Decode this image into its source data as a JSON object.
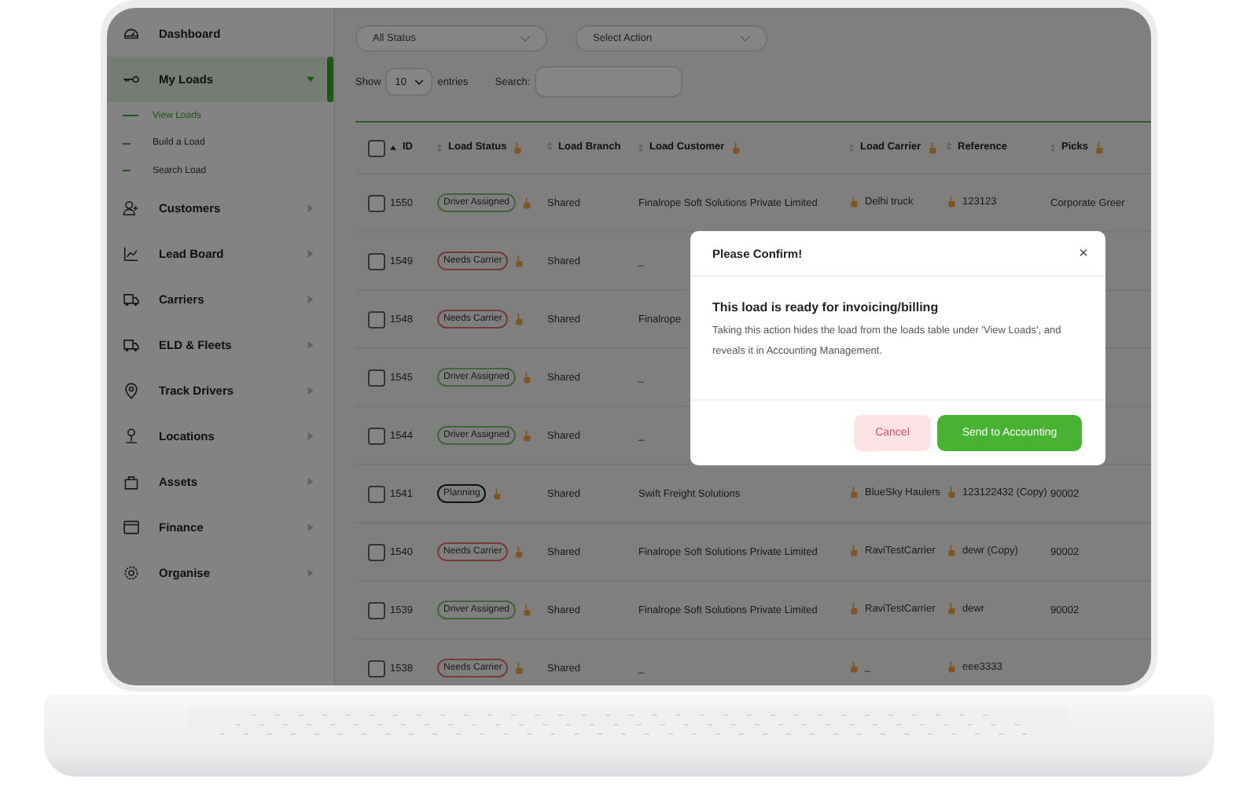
{
  "sidebar": {
    "items": [
      {
        "label": "Dashboard",
        "selected": false
      },
      {
        "label": "My Loads",
        "selected": true,
        "expanded": true,
        "children": [
          {
            "label": "View Loads",
            "selected": true
          },
          {
            "label": "Build a Load",
            "selected": false
          },
          {
            "label": "Search Load",
            "selected": false
          }
        ]
      },
      {
        "label": "Customers",
        "selected": false,
        "expanded": false
      },
      {
        "label": "Lead Board",
        "selected": false,
        "expanded": false
      },
      {
        "label": "Carriers",
        "selected": false,
        "expanded": false
      },
      {
        "label": "ELD & Fleets",
        "selected": false,
        "expanded": false
      },
      {
        "label": "Track Drivers",
        "selected": false,
        "expanded": false
      },
      {
        "label": "Locations",
        "selected": false,
        "expanded": false
      },
      {
        "label": "Assets",
        "selected": false,
        "expanded": false
      },
      {
        "label": "Finance",
        "selected": false,
        "expanded": false
      },
      {
        "label": "Organise",
        "selected": false,
        "expanded": false
      }
    ]
  },
  "filters": [
    {
      "value": "All Status"
    },
    {
      "value": "Select Action"
    }
  ],
  "length_control": {
    "before": "Show",
    "value": "10",
    "after": "entries"
  },
  "search": {
    "label": "Search:"
  },
  "table": {
    "header_checked": false,
    "columns": [
      {
        "label": "ID",
        "sorted": true,
        "hand": false
      },
      {
        "label": "Load Status",
        "sorted": false,
        "hand": true
      },
      {
        "label": "Load Branch",
        "sorted": false,
        "hand": false
      },
      {
        "label": "Load Customer",
        "sorted": false,
        "hand": true
      },
      {
        "label": "Load Carrier",
        "sorted": false,
        "hand": true
      },
      {
        "label": "Reference",
        "sorted": false,
        "hand": false
      },
      {
        "label": "Picks",
        "sorted": false,
        "hand": true
      }
    ],
    "rows": [
      {
        "checked": false,
        "id": "1550",
        "status": {
          "text": "Driver Assigned",
          "kind": "assigned"
        },
        "branch": "Shared",
        "customer": "Finalrope Soft Solutions Private Limited",
        "carrier": "Delhi truck",
        "reference": "123123",
        "picks": "Corporate Greer"
      },
      {
        "checked": false,
        "id": "1549",
        "status": {
          "text": "Needs Carrier",
          "kind": "needs"
        },
        "branch": "Shared",
        "customer": "_"
      },
      {
        "checked": false,
        "id": "1548",
        "status": {
          "text": "Needs Carrier",
          "kind": "needs"
        },
        "branch": "Shared",
        "customer": "Finalrope"
      },
      {
        "checked": false,
        "id": "1545",
        "status": {
          "text": "Driver Assigned",
          "kind": "assigned"
        },
        "branch": "Shared",
        "customer": "_"
      },
      {
        "checked": false,
        "id": "1544",
        "status": {
          "text": "Driver Assigned",
          "kind": "assigned"
        },
        "branch": "Shared",
        "customer": "_"
      },
      {
        "checked": false,
        "id": "1541",
        "status": {
          "text": "Planning",
          "kind": "planning"
        },
        "branch": "Shared",
        "customer": "Swift Freight Solutions",
        "carrier": "BlueSky Haulers",
        "reference": "123122432 (Copy)",
        "picks": "90002"
      },
      {
        "checked": false,
        "id": "1540",
        "status": {
          "text": "Needs Carrier",
          "kind": "needs"
        },
        "branch": "Shared",
        "customer": "Finalrope Soft Solutions Private Limited",
        "carrier": "RaviTestCarrier",
        "reference": "dewr (Copy)",
        "picks": "90002"
      },
      {
        "checked": false,
        "id": "1539",
        "status": {
          "text": "Driver Assigned",
          "kind": "assigned"
        },
        "branch": "Shared",
        "customer": "Finalrope Soft Solutions Private Limited",
        "carrier": "RaviTestCarrier",
        "reference": "dewr",
        "picks": "90002"
      },
      {
        "checked": false,
        "id": "1538",
        "status": {
          "text": "Needs Carrier",
          "kind": "needs"
        },
        "branch": "Shared",
        "customer": "_",
        "carrier": "_",
        "reference": "eee3333"
      }
    ]
  },
  "modal": {
    "title": "Please Confirm!",
    "close": "×",
    "heading": "This load is ready for invoicing/billing",
    "message": "Taking this action hides the load from the loads table under 'View Loads', and reveals it in Accounting Management.",
    "buttons": [
      {
        "label": "Cancel",
        "kind": "cancel"
      },
      {
        "label": "Send to Accounting",
        "kind": "primary"
      }
    ]
  }
}
